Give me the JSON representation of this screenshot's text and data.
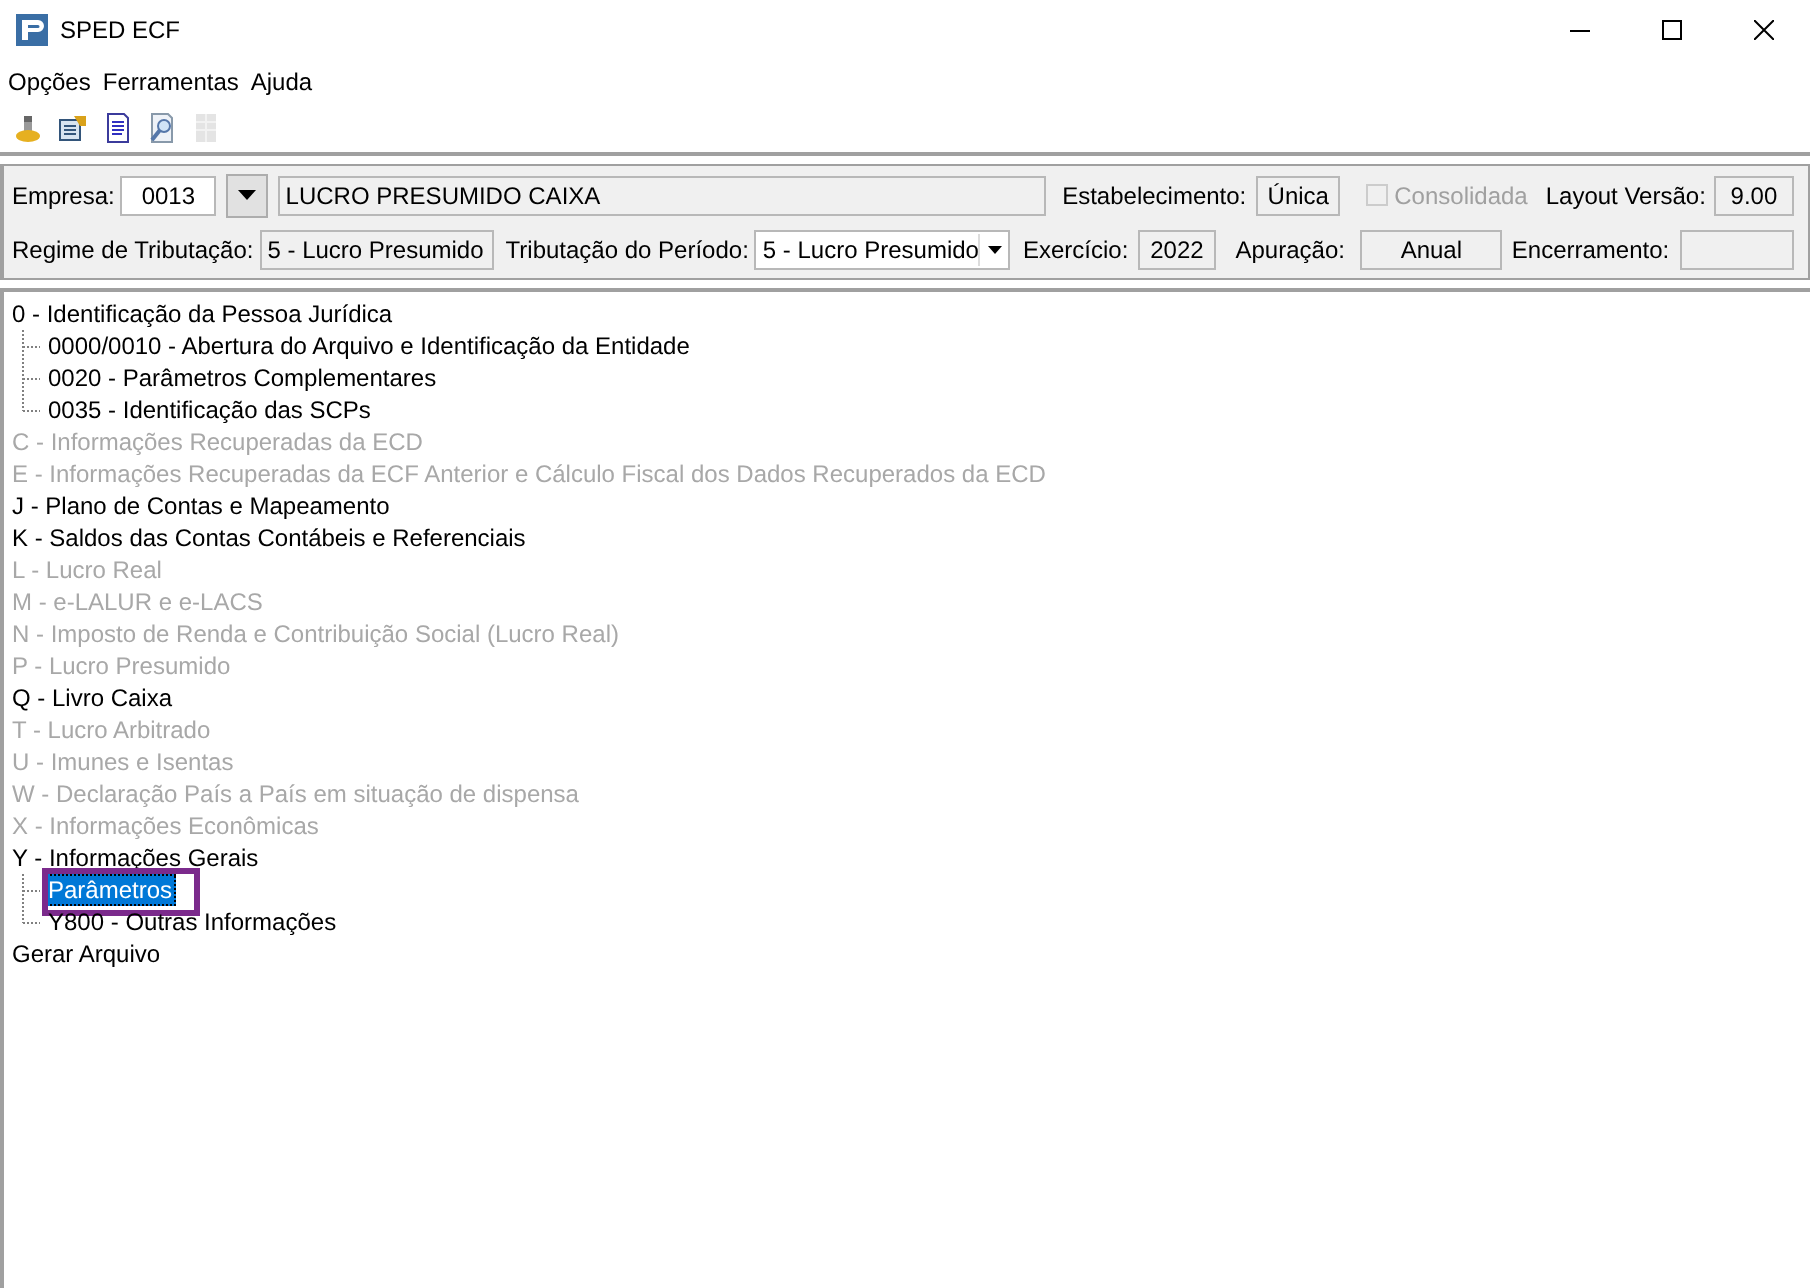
{
  "window": {
    "title": "SPED ECF"
  },
  "menu": [
    {
      "label": "Opções"
    },
    {
      "label": "Ferramentas"
    },
    {
      "label": "Ajuda"
    }
  ],
  "toolbar": [
    {
      "disabled": false
    },
    {
      "disabled": false
    },
    {
      "disabled": false
    },
    {
      "disabled": false
    },
    {
      "disabled": true
    }
  ],
  "header": {
    "empresa_label": "Empresa:",
    "empresa_code": "0013",
    "empresa_name": "LUCRO PRESUMIDO CAIXA",
    "estabelecimento_label": "Estabelecimento:",
    "estabelecimento": "Única",
    "consolidada": {
      "label": "Consolidada",
      "checked": false,
      "disabled": true
    },
    "layout_label": "Layout Versão:",
    "layout": "9.00",
    "regime_label": "Regime de Tributação:",
    "regime": "5 - Lucro Presumido",
    "periodo_label": "Tributação do Período:",
    "periodo": "5 - Lucro Presumido",
    "exercicio_label": "Exercício:",
    "exercicio": "2022",
    "apuracao_label": "Apuração:",
    "apuracao": "Anual",
    "encerramento_label": "Encerramento:"
  },
  "tree": [
    {
      "label": "0 - Identificação da Pessoa Jurídica",
      "disabled": false,
      "selected": false,
      "children": [
        {
          "label": "0000/0010 - Abertura do Arquivo e Identificação da Entidade",
          "disabled": false,
          "selected": false
        },
        {
          "label": "0020 - Parâmetros Complementares",
          "disabled": false,
          "selected": false
        },
        {
          "label": "0035 - Identificação das SCPs",
          "disabled": false,
          "selected": false
        }
      ]
    },
    {
      "label": "C - Informações Recuperadas da ECD",
      "disabled": true,
      "selected": false
    },
    {
      "label": "E - Informações Recuperadas da ECF Anterior e Cálculo Fiscal dos Dados Recuperados da ECD",
      "disabled": true,
      "selected": false
    },
    {
      "label": "J - Plano de Contas e Mapeamento",
      "disabled": false,
      "selected": false
    },
    {
      "label": "K - Saldos das Contas Contábeis e Referenciais",
      "disabled": false,
      "selected": false
    },
    {
      "label": "L - Lucro Real",
      "disabled": true,
      "selected": false
    },
    {
      "label": "M - e-LALUR e e-LACS",
      "disabled": true,
      "selected": false
    },
    {
      "label": "N - Imposto de Renda e Contribuição Social (Lucro Real)",
      "disabled": true,
      "selected": false
    },
    {
      "label": "P - Lucro Presumido",
      "disabled": true,
      "selected": false
    },
    {
      "label": "Q - Livro Caixa",
      "disabled": false,
      "selected": false
    },
    {
      "label": "T - Lucro Arbitrado",
      "disabled": true,
      "selected": false
    },
    {
      "label": "U - Imunes e Isentas",
      "disabled": true,
      "selected": false
    },
    {
      "label": "W - Declaração País a País em situação de dispensa",
      "disabled": true,
      "selected": false
    },
    {
      "label": "X - Informações Econômicas",
      "disabled": true,
      "selected": false
    },
    {
      "label": "Y - Informações Gerais",
      "disabled": false,
      "selected": false,
      "children": [
        {
          "label": "Parâmetros",
          "disabled": false,
          "selected": true,
          "highlight_frame": true
        },
        {
          "label": "Y800 - Outras Informações",
          "disabled": false,
          "selected": false
        }
      ]
    },
    {
      "label": "Gerar Arquivo",
      "disabled": false,
      "selected": false
    }
  ]
}
